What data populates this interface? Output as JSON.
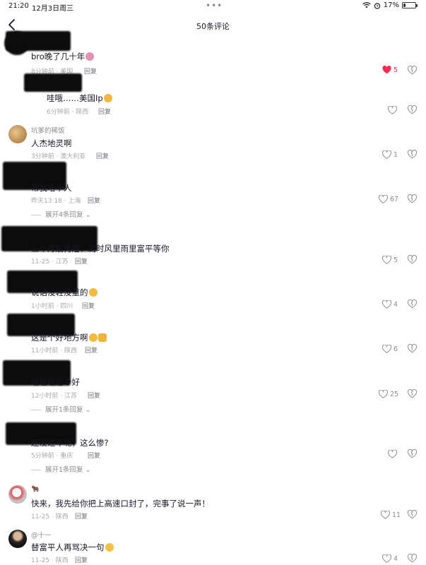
{
  "status_bar": {
    "time": "21:20",
    "date": "12月3日周三",
    "dots": "•••",
    "battery": "17%",
    "battery_level": 0.17
  },
  "header": {
    "title": "50条评论"
  },
  "colors": {
    "liked": "#fe2c55",
    "meta": "#a7a8ad",
    "text": "#161823"
  },
  "comments": [
    {
      "text": "bro晚了几十年",
      "emoji": "wilted-flower-emoji",
      "meta": "8分钟前 · 美国",
      "reply": "回复",
      "likes": "5",
      "liked": true
    },
    {
      "text": "哇哦……美国Ip",
      "emoji": "grin-emoji",
      "meta": "6分钟前 · 陕西",
      "reply": "回复",
      "likes": ""
    },
    {
      "username": "坑爹的稀饭",
      "text": "人杰地灵啊",
      "meta": "3分钟前 · 澳大利亚",
      "reply": "回复",
      "likes": "1"
    },
    {
      "text": "帮我啥个人",
      "meta": "昨天13:18 · 上海",
      "reply": "回复",
      "likes": "67",
      "expand": "展开4条回复"
    },
    {
      "text": "三个月后再屠、到时风里雨里富平等你",
      "meta": "11-25 · 江苏",
      "reply": "回复",
      "likes": "5"
    },
    {
      "text": "说话没轻没重的",
      "emoji": "rofl-emoji",
      "meta": "1小时前 · 四川",
      "reply": "回复",
      "likes": "4"
    },
    {
      "text": "这是个好地方啊",
      "emoji": "grin-thumbs-emoji",
      "meta": "11小时前 · 陕西",
      "reply": "回复",
      "likes": "6"
    },
    {
      "text": "哇哇哇这个好",
      "meta": "12小时前 · 江苏",
      "reply": "回复",
      "likes": "25",
      "expand": "展开1条回复"
    },
    {
      "text": "还没过年呢，这么惨?",
      "meta": "5分钟前 · 重庆",
      "reply": "回复",
      "likes": "",
      "expand": "展开1条回复"
    },
    {
      "username": "🐂",
      "text": "快来，我先给你把上高速口封了，完事了说一声！",
      "meta": "11-25 · 陕西",
      "reply": "回复",
      "likes": "11"
    },
    {
      "username": "@十一",
      "text": "替富平人再骂决一句",
      "emoji": "flushed-emoji",
      "meta": "11-25 · 陕西",
      "reply": "回复",
      "likes": "4"
    }
  ]
}
